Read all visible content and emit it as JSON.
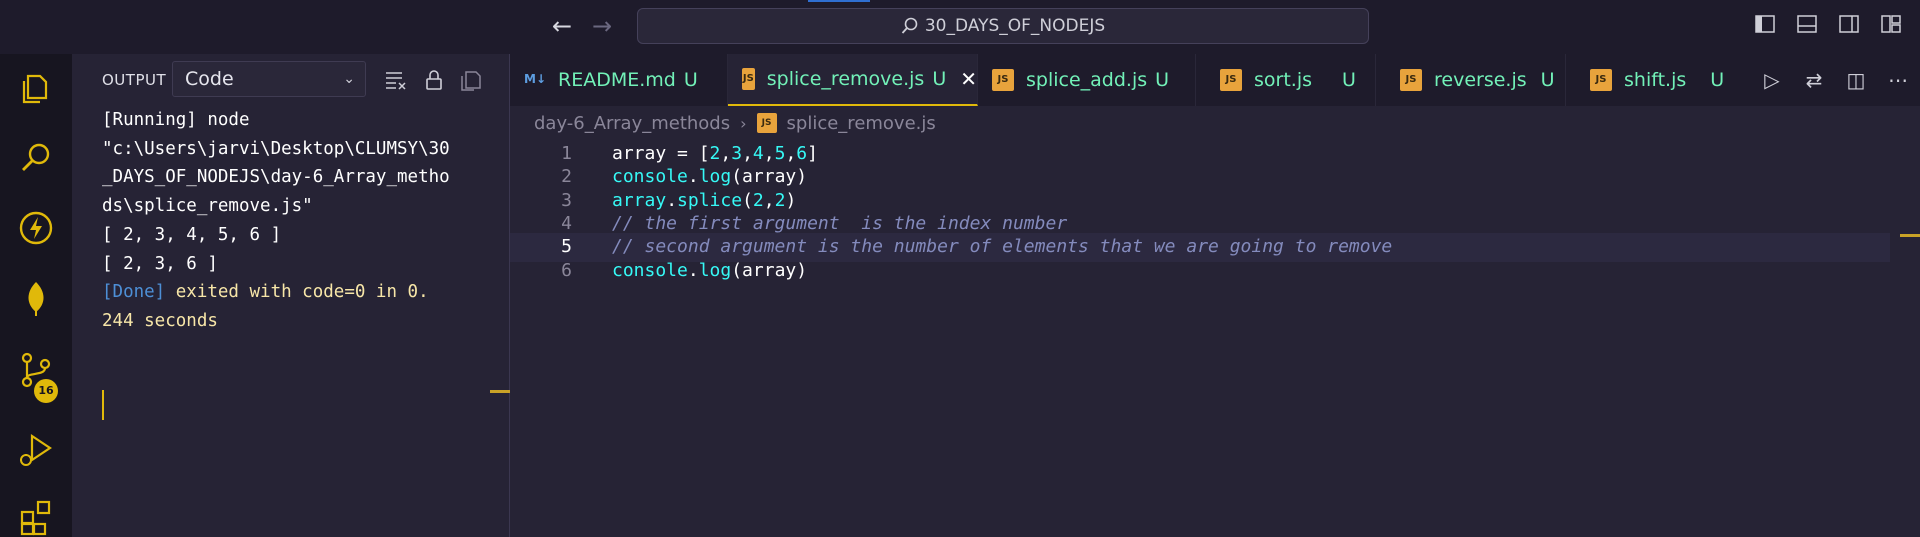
{
  "titlebar": {
    "search_text": "30_DAYS_OF_NODEJS"
  },
  "activity": {
    "source_control_badge": "16"
  },
  "panel": {
    "title": "OUTPUT",
    "selected_channel": "Code",
    "output_lines": [
      "[Running] node",
      "\"c:\\Users\\jarvi\\Desktop\\CLUMSY\\30",
      "_DAYS_OF_NODEJS\\day-6_Array_metho",
      "ds\\splice_remove.js\"",
      "[ 2, 3, 4, 5, 6 ]",
      "[ 2, 3, 6 ]",
      ""
    ],
    "done_tag": "[Done]",
    "done_text_1": " exited with code=0 in 0.",
    "done_text_2": "244 seconds"
  },
  "tabs": [
    {
      "label": "README.md",
      "icon": "M↓",
      "status": "U"
    },
    {
      "label": "splice_remove.js",
      "icon": "JS",
      "status": "U",
      "active": true
    },
    {
      "label": "splice_add.js",
      "icon": "JS",
      "status": "U"
    },
    {
      "label": "sort.js",
      "icon": "JS",
      "status": "U"
    },
    {
      "label": "reverse.js",
      "icon": "JS",
      "status": "U"
    },
    {
      "label": "shift.js",
      "icon": "JS",
      "status": "U"
    }
  ],
  "breadcrumb": {
    "folder": "day-6_Array_methods",
    "file": "splice_remove.js",
    "file_icon": "JS"
  },
  "editor": {
    "current_line": 5,
    "lines": [
      {
        "n": "1",
        "tokens": [
          [
            "plain",
            "array = ["
          ],
          [
            "num",
            "2"
          ],
          [
            "plain",
            ","
          ],
          [
            "num",
            "3"
          ],
          [
            "plain",
            ","
          ],
          [
            "num",
            "4"
          ],
          [
            "plain",
            ","
          ],
          [
            "num",
            "5"
          ],
          [
            "plain",
            ","
          ],
          [
            "num",
            "6"
          ],
          [
            "plain",
            "]"
          ]
        ]
      },
      {
        "n": "2",
        "tokens": [
          [
            "fn",
            "console"
          ],
          [
            "plain",
            "."
          ],
          [
            "fn",
            "log"
          ],
          [
            "plain",
            "(array)"
          ]
        ]
      },
      {
        "n": "3",
        "tokens": [
          [
            "fn",
            "array"
          ],
          [
            "plain",
            "."
          ],
          [
            "fn",
            "splice"
          ],
          [
            "plain",
            "("
          ],
          [
            "num",
            "2"
          ],
          [
            "plain",
            ","
          ],
          [
            "num",
            "2"
          ],
          [
            "plain",
            ")"
          ]
        ]
      },
      {
        "n": "4",
        "tokens": [
          [
            "cm",
            "// the first argument  is the index number"
          ]
        ]
      },
      {
        "n": "5",
        "tokens": [
          [
            "cm",
            "// second argument is the number of elements that we are going to remove"
          ]
        ]
      },
      {
        "n": "6",
        "tokens": [
          [
            "fn",
            "console"
          ],
          [
            "plain",
            "."
          ],
          [
            "fn",
            "log"
          ],
          [
            "plain",
            "(array)"
          ]
        ]
      }
    ]
  },
  "colors": {
    "accent": "#e0b90a",
    "tab_text": "#72f1b8",
    "cyan": "#36f9f6",
    "comment": "#848bbd"
  }
}
